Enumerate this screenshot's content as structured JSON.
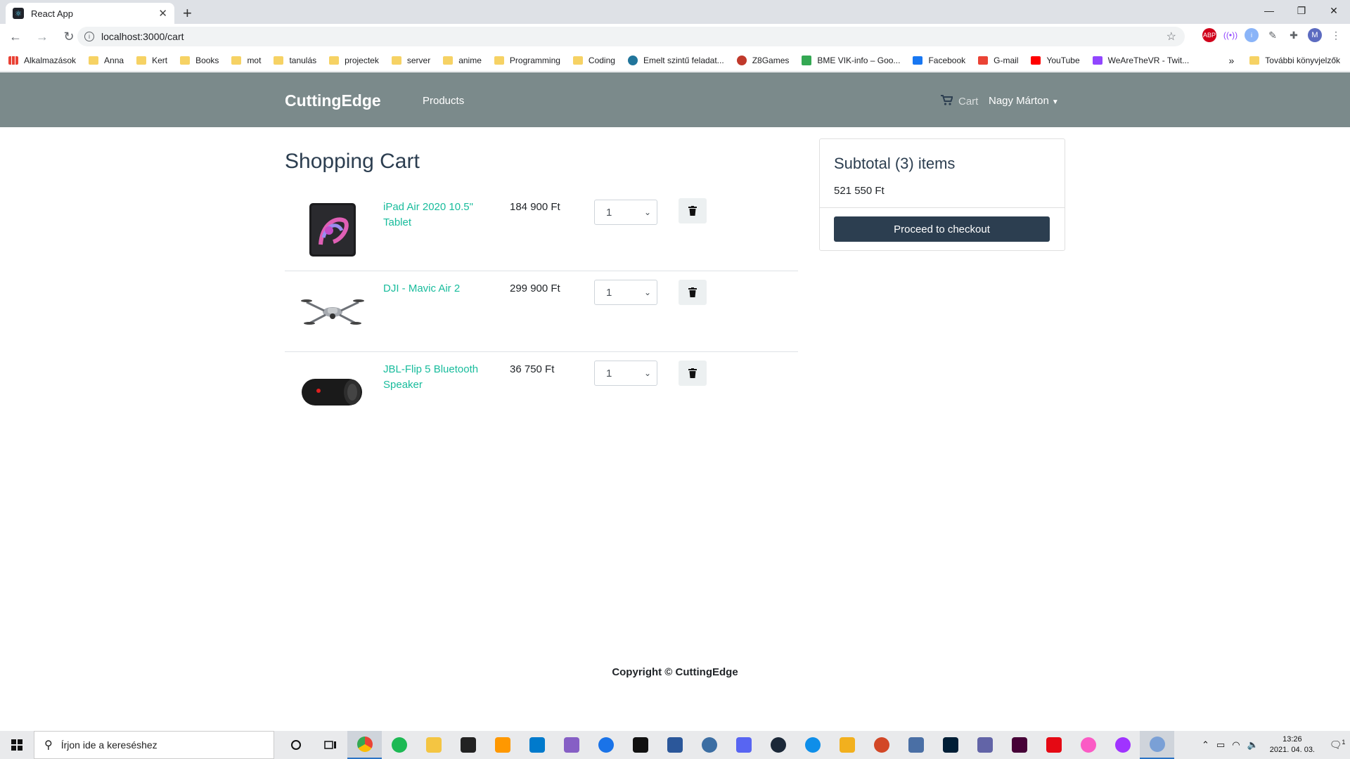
{
  "browser": {
    "tab_title": "React App",
    "url": "localhost:3000/cart",
    "bookmarks": [
      "Alkalmazások",
      "Anna",
      "Kert",
      "Books",
      "mot",
      "tanulás",
      "projectek",
      "server",
      "anime",
      "Programming",
      "Coding",
      "Emelt szintű feladat...",
      "Z8Games",
      "BME VIK-info – Goo...",
      "Facebook",
      "G-mail",
      "YouTube",
      "WeAreTheVR - Twit..."
    ],
    "bookmarks_more": "»",
    "other_bookmarks": "További könyvjelzők",
    "profile_initial": "M"
  },
  "site": {
    "brand": "CuttingEdge",
    "nav_products": "Products",
    "nav_cart": "Cart",
    "user_name": "Nagy Márton"
  },
  "cart": {
    "title": "Shopping Cart",
    "items": [
      {
        "name": "iPad Air 2020 10.5\" Tablet",
        "price": "184 900 Ft",
        "qty": "1"
      },
      {
        "name": "DJI - Mavic Air 2",
        "price": "299 900 Ft",
        "qty": "1"
      },
      {
        "name": "JBL-Flip 5 Bluetooth Speaker",
        "price": "36 750 Ft",
        "qty": "1"
      }
    ]
  },
  "summary": {
    "title": "Subtotal (3) items",
    "subtotal": "521 550 Ft",
    "checkout_label": "Proceed to checkout"
  },
  "footer": {
    "copyright": "Copyright © CuttingEdge"
  },
  "taskbar": {
    "search_placeholder": "Írjon ide a kereséshez",
    "time": "13:26",
    "date": "2021. 04. 03.",
    "notification_count": "1"
  }
}
